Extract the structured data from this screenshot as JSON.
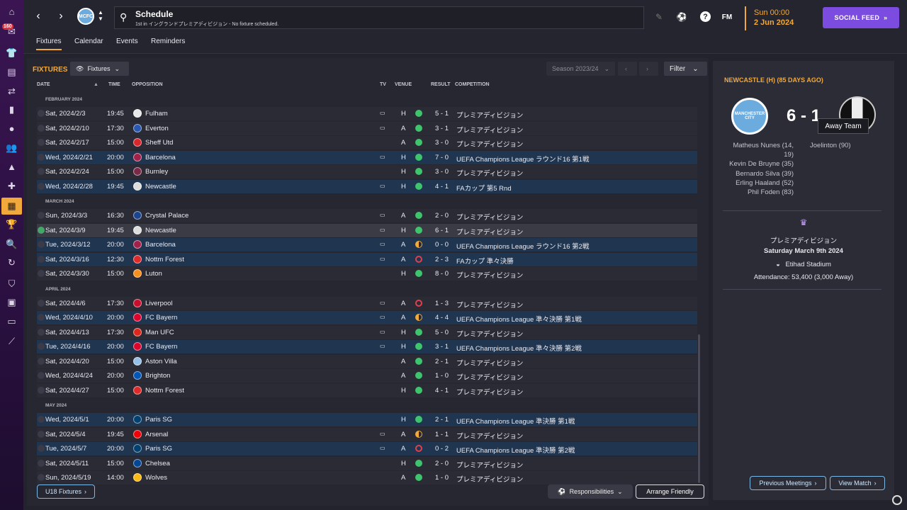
{
  "sidebar": {
    "badge": "160",
    "items": [
      "home",
      "inbox",
      "squad",
      "tactics",
      "transfers",
      "data-hub",
      "dynamics",
      "staff",
      "training",
      "medical",
      "schedule",
      "competitions",
      "scouting",
      "club-vision",
      "club-info",
      "finances",
      "dev-centre",
      "transfers-alt"
    ]
  },
  "header": {
    "title": "Schedule",
    "subtitle": "1st in イングランドプレミアディビジョン - No fixture scheduled.",
    "fm_label": "FM",
    "time": "Sun 00:00",
    "date": "2 Jun 2024",
    "social_label": "SOCIAL FEED",
    "club_badge_text": "MCFC",
    "help_label": "?"
  },
  "tabs": [
    "Fixtures",
    "Calendar",
    "Events",
    "Reminders"
  ],
  "fixtures": {
    "section_title": "FIXTURES",
    "view_dropdown": "Fixtures",
    "season": "Season 2023/24",
    "filter_label": "Filter",
    "columns": {
      "date": "DATE",
      "time": "TIME",
      "opposition": "OPPOSITION",
      "tv": "TV",
      "venue": "VENUE",
      "result": "RESULT",
      "competition": "COMPETITION"
    },
    "months": [
      "FEBRUARY 2024",
      "MARCH 2024",
      "APRIL 2024",
      "MAY 2024"
    ],
    "rows": [
      {
        "date": "Sat, 2024/2/3",
        "time": "19:45",
        "opp": "Fulham",
        "tv": true,
        "venue": "H",
        "result": "win",
        "score": "5 - 1",
        "comp": "プレミアディビジョン",
        "crest": "#e8e8e8",
        "hl": false
      },
      {
        "date": "Sat, 2024/2/10",
        "time": "17:30",
        "opp": "Everton",
        "tv": true,
        "venue": "A",
        "result": "win",
        "score": "3 - 1",
        "comp": "プレミアディビジョン",
        "crest": "#2a58b0",
        "hl": false
      },
      {
        "date": "Sat, 2024/2/17",
        "time": "15:00",
        "opp": "Sheff Utd",
        "tv": false,
        "venue": "A",
        "result": "win",
        "score": "3 - 0",
        "comp": "プレミアディビジョン",
        "crest": "#d8282e",
        "hl": false
      },
      {
        "date": "Wed, 2024/2/21",
        "time": "20:00",
        "opp": "Barcelona",
        "tv": true,
        "venue": "H",
        "result": "win",
        "score": "7 - 0",
        "comp": "UEFA Champions League ラウンド16 第1戦",
        "crest": "#a2214b",
        "hl": true
      },
      {
        "date": "Sat, 2024/2/24",
        "time": "15:00",
        "opp": "Burnley",
        "tv": false,
        "venue": "H",
        "result": "win",
        "score": "3 - 0",
        "comp": "プレミアディビジョン",
        "crest": "#7a2a48",
        "hl": false
      },
      {
        "date": "Wed, 2024/2/28",
        "time": "19:45",
        "opp": "Newcastle",
        "tv": true,
        "venue": "H",
        "result": "win",
        "score": "4 - 1",
        "comp": "FAカップ 第5 Rnd",
        "crest": "#dddddd",
        "hl": true
      },
      {
        "date": "Sun, 2024/3/3",
        "time": "16:30",
        "opp": "Crystal Palace",
        "tv": true,
        "venue": "A",
        "result": "win",
        "score": "2 - 0",
        "comp": "プレミアディビジョン",
        "crest": "#1b458f",
        "hl": false
      },
      {
        "date": "Sat, 2024/3/9",
        "time": "19:45",
        "opp": "Newcastle",
        "tv": true,
        "venue": "H",
        "result": "win",
        "score": "6 - 1",
        "comp": "プレミアディビジョン",
        "crest": "#dddddd",
        "hl": false,
        "sel": true
      },
      {
        "date": "Tue, 2024/3/12",
        "time": "20:00",
        "opp": "Barcelona",
        "tv": true,
        "venue": "A",
        "result": "draw",
        "score": "0 - 0",
        "comp": "UEFA Champions League ラウンド16 第2戦",
        "crest": "#a2214b",
        "hl": true
      },
      {
        "date": "Sat, 2024/3/16",
        "time": "12:30",
        "opp": "Nottm Forest",
        "tv": true,
        "venue": "A",
        "result": "loss",
        "score": "2 - 3",
        "comp": "FAカップ 準々決勝",
        "crest": "#dd2a2a",
        "hl": true
      },
      {
        "date": "Sat, 2024/3/30",
        "time": "15:00",
        "opp": "Luton",
        "tv": false,
        "venue": "H",
        "result": "win",
        "score": "8 - 0",
        "comp": "プレミアディビジョン",
        "crest": "#f78f1e",
        "hl": false
      },
      {
        "date": "Sat, 2024/4/6",
        "time": "17:30",
        "opp": "Liverpool",
        "tv": true,
        "venue": "A",
        "result": "loss",
        "score": "1 - 3",
        "comp": "プレミアディビジョン",
        "crest": "#c8102e",
        "hl": false
      },
      {
        "date": "Wed, 2024/4/10",
        "time": "20:00",
        "opp": "FC Bayern",
        "tv": true,
        "venue": "A",
        "result": "draw",
        "score": "4 - 4",
        "comp": "UEFA Champions League 準々決勝 第1戦",
        "crest": "#dc052d",
        "hl": true
      },
      {
        "date": "Sat, 2024/4/13",
        "time": "17:30",
        "opp": "Man UFC",
        "tv": true,
        "venue": "H",
        "result": "win",
        "score": "5 - 0",
        "comp": "プレミアディビジョン",
        "crest": "#da291c",
        "hl": false
      },
      {
        "date": "Tue, 2024/4/16",
        "time": "20:00",
        "opp": "FC Bayern",
        "tv": true,
        "venue": "H",
        "result": "win",
        "score": "3 - 1",
        "comp": "UEFA Champions League 準々決勝 第2戦",
        "crest": "#dc052d",
        "hl": true
      },
      {
        "date": "Sat, 2024/4/20",
        "time": "15:00",
        "opp": "Aston Villa",
        "tv": false,
        "venue": "A",
        "result": "win",
        "score": "2 - 1",
        "comp": "プレミアディビジョン",
        "crest": "#95bfe5",
        "hl": false
      },
      {
        "date": "Wed, 2024/4/24",
        "time": "20:00",
        "opp": "Brighton",
        "tv": false,
        "venue": "A",
        "result": "win",
        "score": "1 - 0",
        "comp": "プレミアディビジョン",
        "crest": "#0057b8",
        "hl": false
      },
      {
        "date": "Sat, 2024/4/27",
        "time": "15:00",
        "opp": "Nottm Forest",
        "tv": false,
        "venue": "H",
        "result": "win",
        "score": "4 - 1",
        "comp": "プレミアディビジョン",
        "crest": "#dd2a2a",
        "hl": false
      },
      {
        "date": "Wed, 2024/5/1",
        "time": "20:00",
        "opp": "Paris SG",
        "tv": false,
        "venue": "H",
        "result": "win",
        "score": "2 - 1",
        "comp": "UEFA Champions League 準決勝 第1戦",
        "crest": "#004170",
        "hl": true
      },
      {
        "date": "Sat, 2024/5/4",
        "time": "19:45",
        "opp": "Arsenal",
        "tv": true,
        "venue": "A",
        "result": "draw",
        "score": "1 - 1",
        "comp": "プレミアディビジョン",
        "crest": "#ef0107",
        "hl": false
      },
      {
        "date": "Tue, 2024/5/7",
        "time": "20:00",
        "opp": "Paris SG",
        "tv": true,
        "venue": "A",
        "result": "loss",
        "score": "0 - 2",
        "comp": "UEFA Champions League 準決勝 第2戦",
        "crest": "#004170",
        "hl": true
      },
      {
        "date": "Sat, 2024/5/11",
        "time": "15:00",
        "opp": "Chelsea",
        "tv": false,
        "venue": "H",
        "result": "win",
        "score": "2 - 0",
        "comp": "プレミアディビジョン",
        "crest": "#034694",
        "hl": false
      },
      {
        "date": "Sun, 2024/5/19",
        "time": "14:00",
        "opp": "Wolves",
        "tv": false,
        "venue": "A",
        "result": "win",
        "score": "1 - 0",
        "comp": "プレミアディビジョン",
        "crest": "#fdb913",
        "hl": false
      }
    ],
    "u18_label": "U18 Fixtures",
    "responsibilities_label": "Responsibilities",
    "arrange_label": "Arrange Friendly"
  },
  "match_panel": {
    "header": "NEWCASTLE (H) (85 DAYS AGO)",
    "score": "6 - 1",
    "tooltip": "Away Team",
    "home_badge_text": "MANCHESTER CITY",
    "home_scorers": [
      "Matheus Nunes (14,",
      "19)",
      "Kevin De Bruyne (35)",
      "Bernardo Silva (39)",
      "Erling Haaland (52)",
      "Phil Foden (83)"
    ],
    "away_scorers": [
      "Joelinton (90)"
    ],
    "competition": "プレミアディビジョン",
    "match_date": "Saturday March 9th 2024",
    "stadium": "Etihad Stadium",
    "attendance": "Attendance: 53,400 (3,000 Away)",
    "prev_label": "Previous Meetings",
    "view_label": "View Match"
  },
  "colors": {
    "accent": "#f2a93b",
    "social": "#7c4ce0",
    "win": "#3ec46d",
    "loss": "#e0404e",
    "highlight_row": "#1f3550"
  }
}
